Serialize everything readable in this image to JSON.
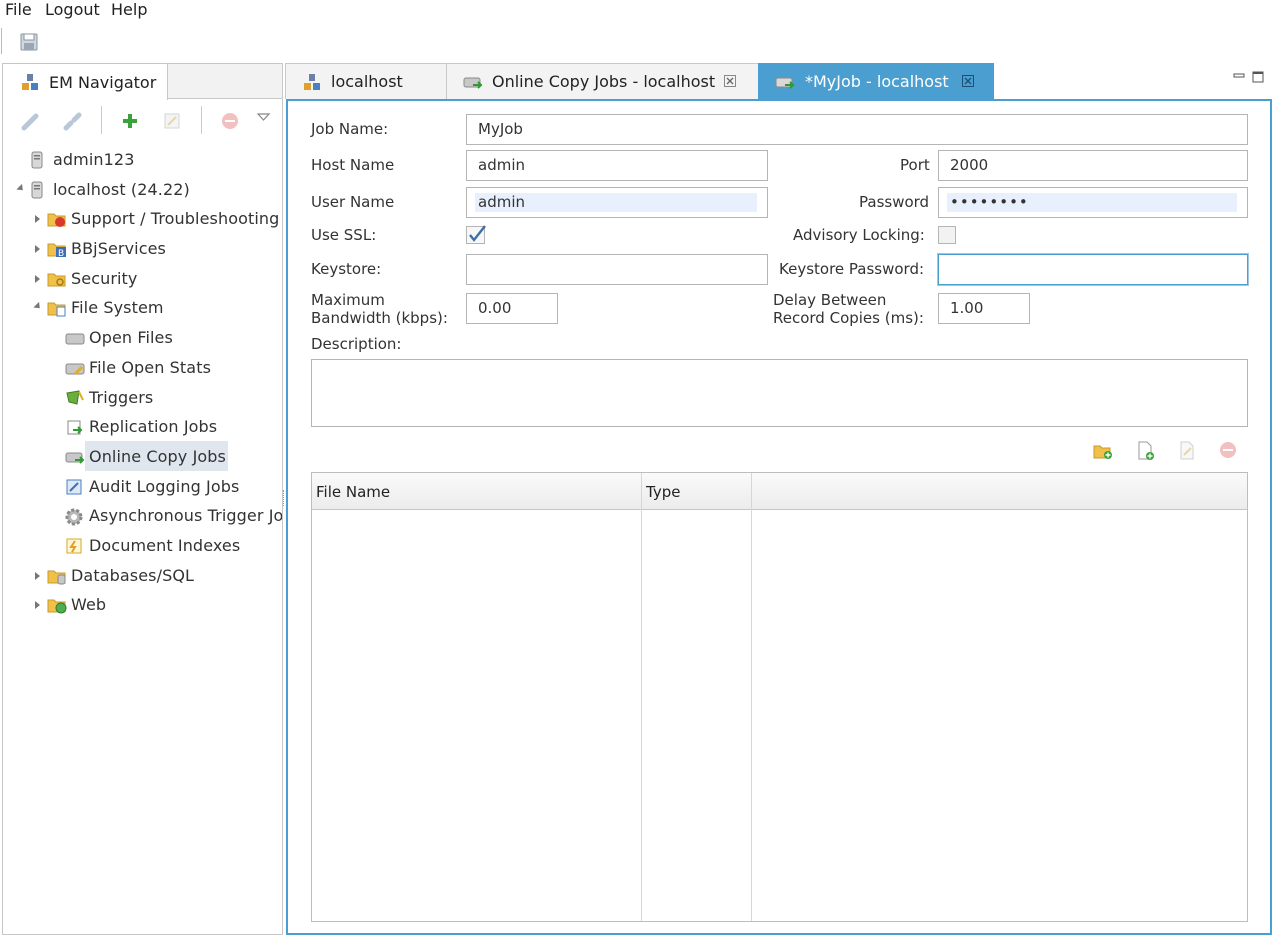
{
  "menu": {
    "file": "File",
    "logout": "Logout",
    "help": "Help"
  },
  "toolbar": {
    "save_icon": "save-icon"
  },
  "navigator": {
    "tab_label": "EM Navigator",
    "tools": [
      "connect-icon",
      "disconnect-icon",
      "add-icon",
      "edit-icon",
      "remove-icon",
      "view-menu-icon"
    ],
    "tree": [
      {
        "label": "admin123",
        "icon": "server-icon"
      },
      {
        "label": "localhost (24.22)",
        "icon": "server-icon"
      },
      {
        "label": "Support / Troubleshooting",
        "icon": "support-folder-icon"
      },
      {
        "label": "BBjServices",
        "icon": "bbj-folder-icon"
      },
      {
        "label": "Security",
        "icon": "security-folder-icon"
      },
      {
        "label": "File System",
        "icon": "filesystem-folder-icon"
      },
      {
        "label": "Open Files",
        "icon": "open-files-icon"
      },
      {
        "label": "File Open Stats",
        "icon": "file-stats-icon"
      },
      {
        "label": "Triggers",
        "icon": "triggers-icon"
      },
      {
        "label": "Replication Jobs",
        "icon": "replication-icon"
      },
      {
        "label": "Online Copy Jobs",
        "icon": "online-copy-icon"
      },
      {
        "label": "Audit Logging Jobs",
        "icon": "audit-icon"
      },
      {
        "label": "Asynchronous Trigger Jo",
        "icon": "gear-icon"
      },
      {
        "label": "Document Indexes",
        "icon": "document-index-icon"
      },
      {
        "label": "Databases/SQL",
        "icon": "database-folder-icon"
      },
      {
        "label": "Web",
        "icon": "web-folder-icon"
      }
    ]
  },
  "tabs": {
    "localhost": "localhost",
    "online_copy": "Online Copy Jobs - localhost",
    "myjob": "*MyJob - localhost"
  },
  "form": {
    "job_name_label": "Job Name:",
    "job_name": "MyJob",
    "host_name_label": "Host Name",
    "host_name": "admin",
    "port_label": "Port",
    "port": "2000",
    "user_name_label": "User Name",
    "user_name": "admin",
    "password_label": "Password",
    "password": "••••••••",
    "use_ssl_label": "Use SSL:",
    "use_ssl": true,
    "advisory_locking_label": "Advisory Locking:",
    "advisory_locking": false,
    "keystore_label": "Keystore:",
    "keystore": "",
    "keystore_password_label": "Keystore Password:",
    "keystore_password": "",
    "max_bw_label_1": "Maximum",
    "max_bw_label_2": "Bandwidth (kbps):",
    "max_bw": "0.00",
    "delay_label_1": "Delay Between",
    "delay_label_2": "Record Copies (ms):",
    "delay": "1.00",
    "description_label": "Description:",
    "description": ""
  },
  "table": {
    "columns": [
      "File Name",
      "Type",
      ""
    ],
    "rows": []
  },
  "colors": {
    "accent": "#4a9fd0",
    "selection": "#dfe6ee"
  }
}
